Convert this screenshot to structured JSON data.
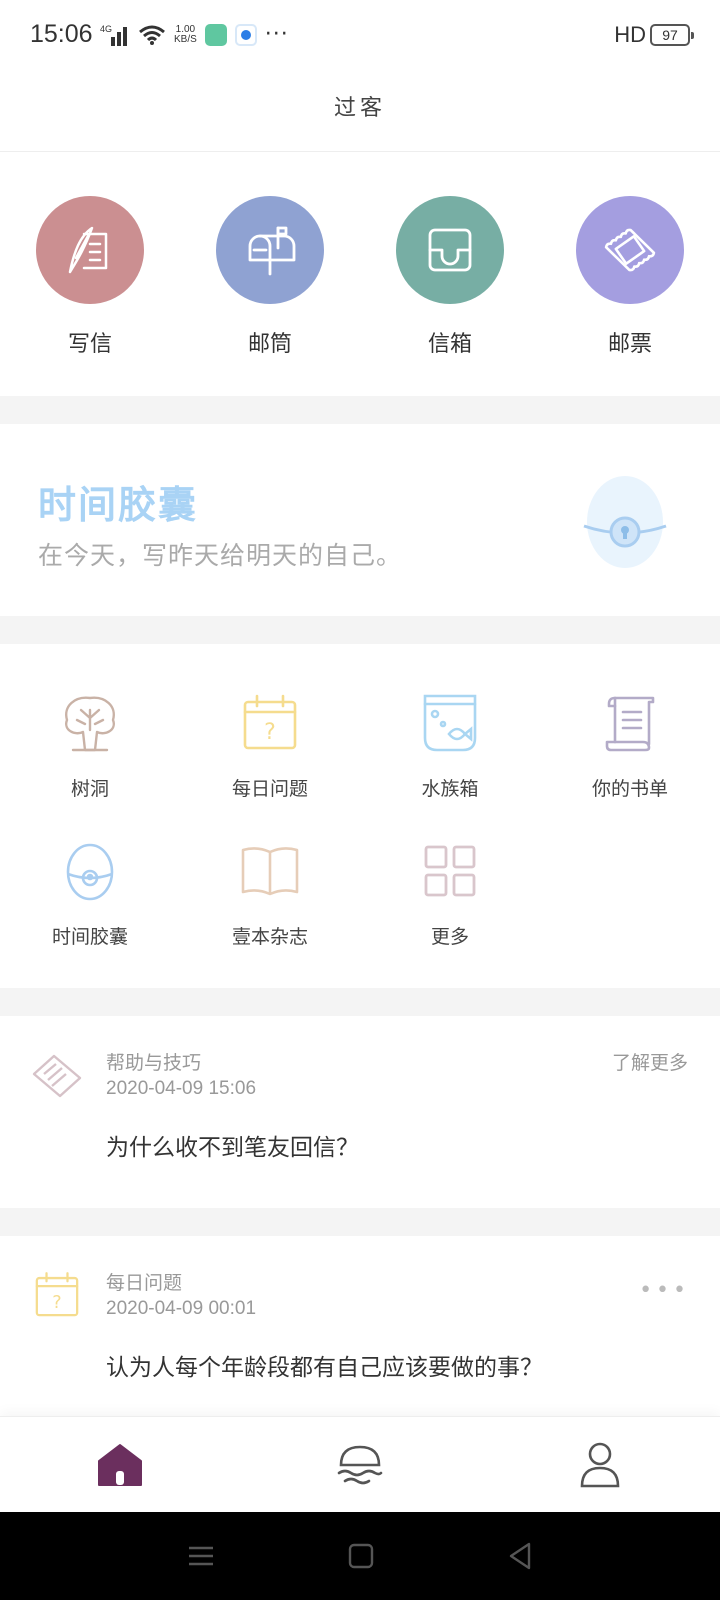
{
  "status_bar": {
    "time": "15:06",
    "network_type": "4G",
    "net_speed_value": "1.00",
    "net_speed_unit": "KB/S",
    "more": "···",
    "hd": "HD",
    "battery": "97"
  },
  "header": {
    "title": "过客"
  },
  "main_actions": [
    {
      "label": "写信",
      "color": "#cb8f91",
      "icon": "quill-letter-icon"
    },
    {
      "label": "邮筒",
      "color": "#8fa2d2",
      "icon": "mailbox-icon"
    },
    {
      "label": "信箱",
      "color": "#77aea4",
      "icon": "inbox-tray-icon"
    },
    {
      "label": "邮票",
      "color": "#a49ee0",
      "icon": "stamp-icon"
    }
  ],
  "banner": {
    "title": "时间胶囊",
    "subtitle": "在今天，写昨天给明天的自己。",
    "icon": "time-capsule-egg-icon"
  },
  "features": [
    {
      "label": "树洞",
      "icon": "tree-icon",
      "color": "#c9b2a6"
    },
    {
      "label": "每日问题",
      "icon": "calendar-question-icon",
      "color": "#f5dc8e"
    },
    {
      "label": "水族箱",
      "icon": "fishbowl-icon",
      "color": "#a9d6f2"
    },
    {
      "label": "你的书单",
      "icon": "scroll-icon",
      "color": "#b3abc8"
    },
    {
      "label": "时间胶囊",
      "icon": "capsule-egg-icon",
      "color": "#a9cdf0"
    },
    {
      "label": "壹本杂志",
      "icon": "open-book-icon",
      "color": "#e6cdb8"
    },
    {
      "label": "更多",
      "icon": "grid-more-icon",
      "color": "#d9c6cc"
    }
  ],
  "cards": [
    {
      "category": "帮助与技巧",
      "date": "2020-04-09 15:06",
      "action": "了解更多",
      "question": "为什么收不到笔友回信？",
      "icon": "handshake-icon"
    },
    {
      "category": "每日问题",
      "date": "2020-04-09 00:01",
      "more": "•••",
      "question": "认为人每个年龄段都有自己应该要做的事？",
      "icon": "calendar-question-icon"
    }
  ],
  "bottom_nav": [
    {
      "name": "home",
      "icon": "home-icon",
      "active": true
    },
    {
      "name": "discover",
      "icon": "island-waves-icon",
      "active": false
    },
    {
      "name": "profile",
      "icon": "person-icon",
      "active": false
    }
  ],
  "colors": {
    "accent": "#6b2f5e",
    "banner_title": "#a9d3f5"
  }
}
